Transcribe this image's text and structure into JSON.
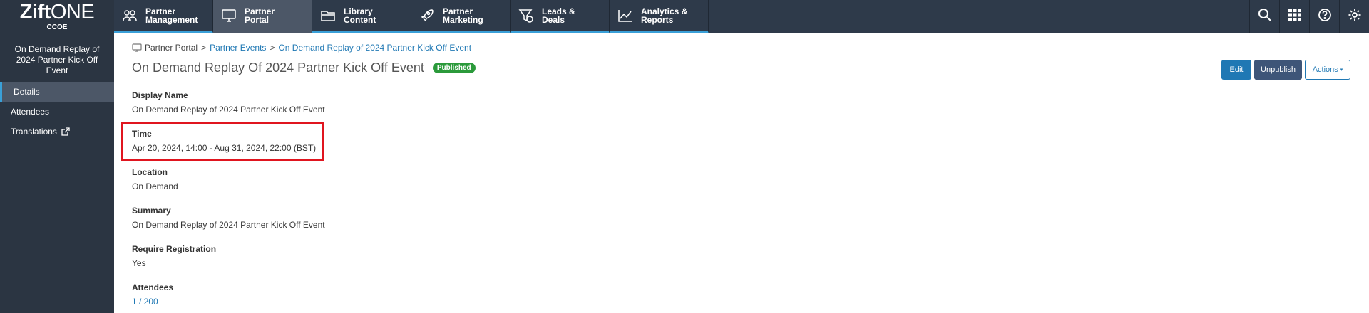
{
  "logo": {
    "bold": "Zift",
    "light": "ONE",
    "sub": "CCOE"
  },
  "nav": [
    {
      "label": "Partner\nManagement",
      "icon": "partners-icon"
    },
    {
      "label": "Partner\nPortal",
      "icon": "monitor-icon",
      "active": true
    },
    {
      "label": "Library\nContent",
      "icon": "folder-icon"
    },
    {
      "label": "Partner\nMarketing",
      "icon": "rocket-icon"
    },
    {
      "label": "Leads &\nDeals",
      "icon": "funnel-dollar-icon"
    },
    {
      "label": "Analytics &\nReports",
      "icon": "line-chart-icon"
    }
  ],
  "top_right": [
    "search-icon",
    "apps-grid-icon",
    "help-icon",
    "settings-icon"
  ],
  "sidebar": {
    "title": "On Demand Replay of 2024 Partner Kick Off Event",
    "items": [
      {
        "label": "Details",
        "active": true
      },
      {
        "label": "Attendees"
      },
      {
        "label": "Translations"
      }
    ]
  },
  "breadcrumb": {
    "root": "Partner Portal",
    "level1": "Partner Events",
    "level2": "On Demand Replay of 2024 Partner Kick Off Event",
    "sep": ">"
  },
  "page": {
    "title": "On Demand Replay Of 2024 Partner Kick Off Event",
    "status": "Published"
  },
  "buttons": {
    "edit": "Edit",
    "unpublish": "Unpublish",
    "actions": "Actions"
  },
  "fields": {
    "display_name": {
      "label": "Display Name",
      "value": "On Demand Replay of 2024 Partner Kick Off Event"
    },
    "time": {
      "label": "Time",
      "value": "Apr 20, 2024, 14:00 - Aug 31, 2024, 22:00 (BST)"
    },
    "location": {
      "label": "Location",
      "value": "On Demand"
    },
    "summary": {
      "label": "Summary",
      "value": "On Demand Replay of 2024 Partner Kick Off Event"
    },
    "require_registration": {
      "label": "Require Registration",
      "value": "Yes"
    },
    "attendees": {
      "label": "Attendees",
      "value": "1 / 200"
    }
  },
  "colors": {
    "accent": "#1f78b4",
    "nav_bg": "#2e3a4a",
    "sidebar_bg": "#2b3542",
    "published": "#2b9a3b",
    "highlight": "#e0151f"
  }
}
